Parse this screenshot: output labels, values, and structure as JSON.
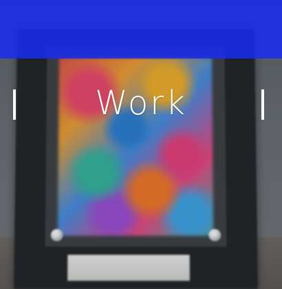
{
  "tile": {
    "title": "Work",
    "accent_color": "#1e32f5",
    "text_color": "#ffffff"
  }
}
